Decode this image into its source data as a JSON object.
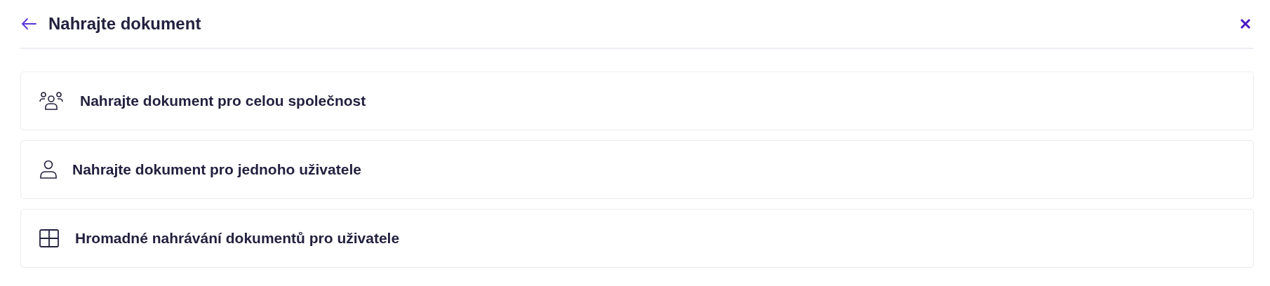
{
  "header": {
    "title": "Nahrajte dokument"
  },
  "options": [
    {
      "kind": "group",
      "label": "Nahrajte dokument pro celou společnost"
    },
    {
      "kind": "person",
      "label": "Nahrajte dokument pro jednoho uživatele"
    },
    {
      "kind": "grid",
      "label": "Hromadné nahrávání dokumentů pro uživatele"
    }
  ]
}
